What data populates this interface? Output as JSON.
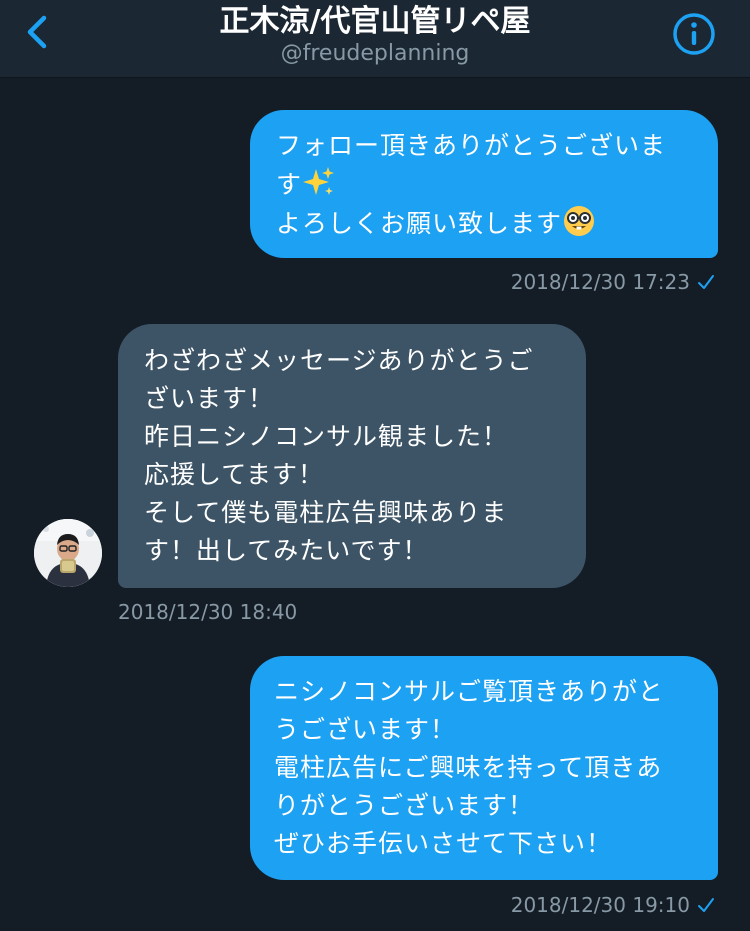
{
  "header": {
    "title": "正木涼/代官山管リペ屋",
    "handle": "@freudeplanning",
    "back_icon": "chevron-left-icon",
    "info_icon": "info-icon",
    "accent": "#1da1f2"
  },
  "messages": [
    {
      "direction": "sent",
      "lines": [
        "フォロー頂きありがとうございま",
        "す",
        "よろしくお願い致します"
      ],
      "emojis": [
        "sparkles-icon",
        "nerd-face-icon"
      ],
      "timestamp": "2018/12/30 17:23",
      "read_icon": "checkmark-icon"
    },
    {
      "direction": "received",
      "lines": [
        "わざわざメッセージありがとうご",
        "ざいます！",
        "昨日ニシノコンサル観ました！",
        "応援してます！",
        "そして僕も電柱広告興味ありま",
        "す！出してみたいです！"
      ],
      "timestamp": "2018/12/30 18:40"
    },
    {
      "direction": "sent",
      "lines": [
        "ニシノコンサルご覧頂きありがと",
        "うございます！",
        "電柱広告にご興味を持って頂きあ",
        "りがとうございます！",
        "ぜひお手伝いさせて下さい！"
      ],
      "timestamp": "2018/12/30 19:10",
      "read_icon": "checkmark-icon"
    }
  ],
  "colors": {
    "background": "#141d26",
    "header_bg": "#1b2733",
    "sent_bubble": "#1da1f2",
    "received_bubble": "#3d5466",
    "muted_text": "#8899a6"
  }
}
